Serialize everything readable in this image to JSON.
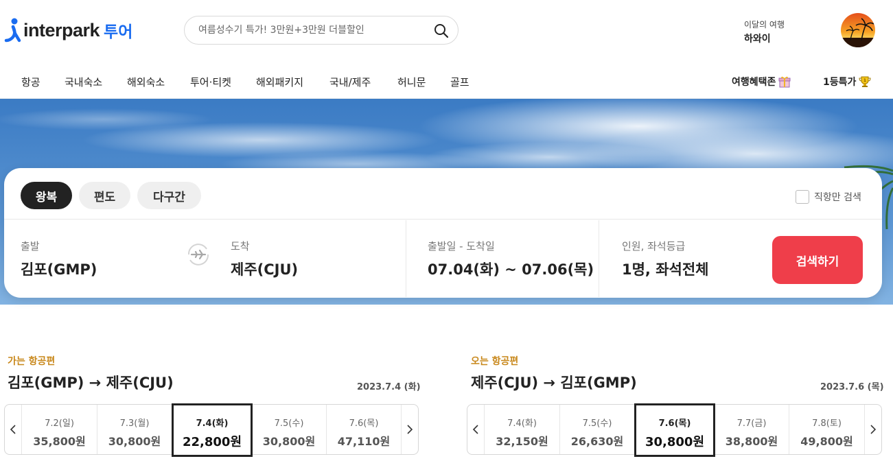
{
  "brand": {
    "name": "interpark",
    "sub": "투어"
  },
  "search": {
    "placeholder": "여름성수기 특가! 3만원+3만원 더블할인"
  },
  "trip": {
    "label": "이달의 여행",
    "value": "하와이"
  },
  "nav": {
    "items": [
      "항공",
      "국내숙소",
      "해외숙소",
      "투어·티켓",
      "해외패키지",
      "국내/제주",
      "허니문",
      "골프"
    ],
    "benefits": "여행혜택존",
    "deals": "1등특가"
  },
  "panel": {
    "tabs": [
      "왕복",
      "편도",
      "다구간"
    ],
    "direct_only": "직항만 검색",
    "departure_label": "출발",
    "departure_value": "김포(GMP)",
    "arrival_label": "도착",
    "arrival_value": "제주(CJU)",
    "dates_label": "출발일 - 도착일",
    "dates_value": "07.04(화) ~ 07.06(목)",
    "pax_label": "인원, 좌석등급",
    "pax_value": "1명, 좌석전체",
    "search_button": "검색하기"
  },
  "outbound": {
    "label": "가는 항공편",
    "route": "김포(GMP) → 제주(CJU)",
    "date": "2023.7.4 (화)",
    "days": [
      {
        "date": "7.2(일)",
        "price": "35,800원"
      },
      {
        "date": "7.3(월)",
        "price": "30,800원"
      },
      {
        "date": "7.4(화)",
        "price": "22,800원"
      },
      {
        "date": "7.5(수)",
        "price": "30,800원"
      },
      {
        "date": "7.6(목)",
        "price": "47,110원"
      }
    ],
    "selected_index": 2
  },
  "inbound": {
    "label": "오는 항공편",
    "route": "제주(CJU) → 김포(GMP)",
    "date": "2023.7.6 (목)",
    "days": [
      {
        "date": "7.4(화)",
        "price": "32,150원"
      },
      {
        "date": "7.5(수)",
        "price": "26,630원"
      },
      {
        "date": "7.6(목)",
        "price": "30,800원"
      },
      {
        "date": "7.7(금)",
        "price": "38,800원"
      },
      {
        "date": "7.8(토)",
        "price": "49,800원"
      }
    ],
    "selected_index": 2
  },
  "colors": {
    "accent": "#1a6cf0",
    "search_button": "#ef3e4a",
    "section_label": "#c8871a"
  }
}
